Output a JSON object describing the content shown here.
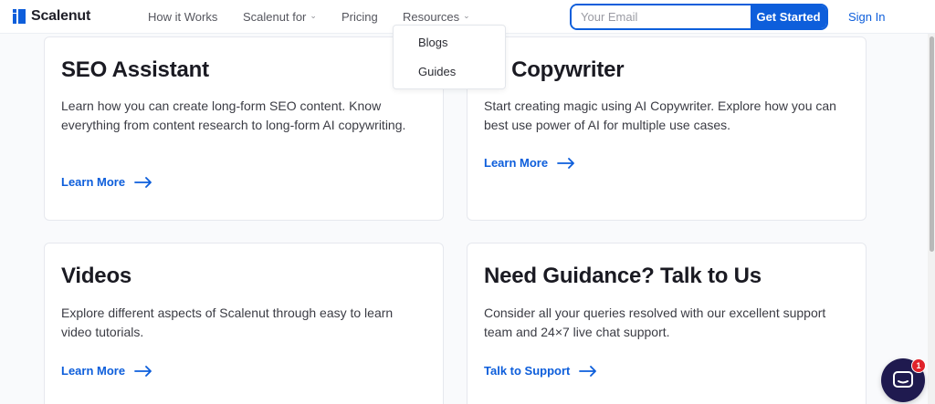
{
  "header": {
    "brand": "Scalenut",
    "nav": [
      {
        "label": "How it Works"
      },
      {
        "label": "Scalenut for"
      },
      {
        "label": "Pricing"
      },
      {
        "label": "Resources"
      }
    ],
    "email_placeholder": "Your Email",
    "cta_label": "Get Started",
    "signin_label": "Sign In"
  },
  "resources_menu": {
    "items": [
      {
        "label": "Blogs"
      },
      {
        "label": "Guides"
      }
    ]
  },
  "cards": [
    {
      "title": "SEO Assistant",
      "description": "Learn how you can create long-form SEO content. Know everything from content research to long-form AI copywriting.",
      "link": "Learn More"
    },
    {
      "title": "AI Copywriter",
      "description": "Start creating magic using AI Copywriter. Explore how you can best use power of AI for multiple use cases.",
      "link": "Learn More"
    },
    {
      "title": "Videos",
      "description": "Explore different aspects of Scalenut through easy to learn video tutorials.",
      "link": "Learn More"
    },
    {
      "title": "Need Guidance? Talk to Us",
      "description": "Consider all your queries resolved with our excellent support team and 24×7 live chat support.",
      "link": "Talk to Support"
    }
  ],
  "chat": {
    "unread_count": "1"
  },
  "colors": {
    "accent": "#0d5edb",
    "chat_bg": "#1f1a4f",
    "badge": "#e0232b"
  }
}
